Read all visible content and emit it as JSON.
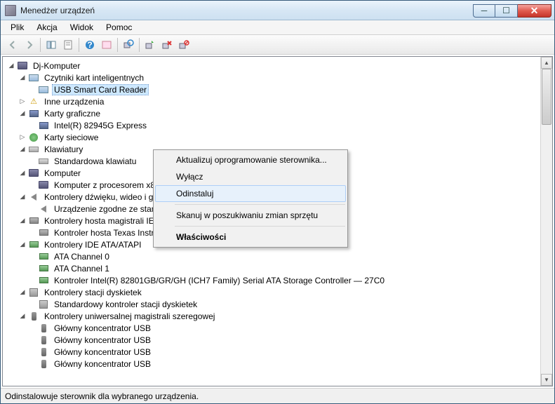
{
  "window": {
    "title": "Menedżer urządzeń"
  },
  "menu": {
    "file": "Plik",
    "action": "Akcja",
    "view": "Widok",
    "help": "Pomoc"
  },
  "tree": {
    "root": "Dj-Komputer",
    "n0": {
      "label": "Czytniki kart inteligentnych",
      "c0": "USB Smart Card Reader"
    },
    "n1": {
      "label": "Inne urządzenia"
    },
    "n2": {
      "label": "Karty graficzne",
      "c0": "Intel(R) 82945G Express"
    },
    "n3": {
      "label": "Karty sieciowe"
    },
    "n4": {
      "label": "Klawiatury",
      "c0": "Standardowa klawiatu"
    },
    "n5": {
      "label": "Komputer",
      "c0": "Komputer z procesorem x86 obsługujący interfejs ACPI"
    },
    "n6": {
      "label": "Kontrolery dźwięku, wideo i gier",
      "c0": "Urządzenie zgodne ze standardem High Definition Audio"
    },
    "n7": {
      "label": "Kontrolery hosta magistrali IEEE 1394",
      "c0": "Kontroler hosta Texas Instruments 1394 zgodny z OHCI"
    },
    "n8": {
      "label": "Kontrolery IDE ATA/ATAPI",
      "c0": "ATA Channel 0",
      "c1": "ATA Channel 1",
      "c2": "Kontroler Intel(R) 82801GB/GR/GH (ICH7 Family) Serial ATA Storage Controller — 27C0"
    },
    "n9": {
      "label": "Kontrolery stacji dyskietek",
      "c0": "Standardowy kontroler stacji dyskietek"
    },
    "n10": {
      "label": "Kontrolery uniwersalnej magistrali szeregowej",
      "c0": "Główny koncentrator USB",
      "c1": "Główny koncentrator USB",
      "c2": "Główny koncentrator USB",
      "c3": "Główny koncentrator USB"
    }
  },
  "context_menu": {
    "update": "Aktualizuj oprogramowanie sterownika...",
    "disable": "Wyłącz",
    "uninstall": "Odinstaluj",
    "scan": "Skanuj w poszukiwaniu zmian sprzętu",
    "properties": "Właściwości"
  },
  "status": "Odinstalowuje sterownik dla wybranego urządzenia."
}
